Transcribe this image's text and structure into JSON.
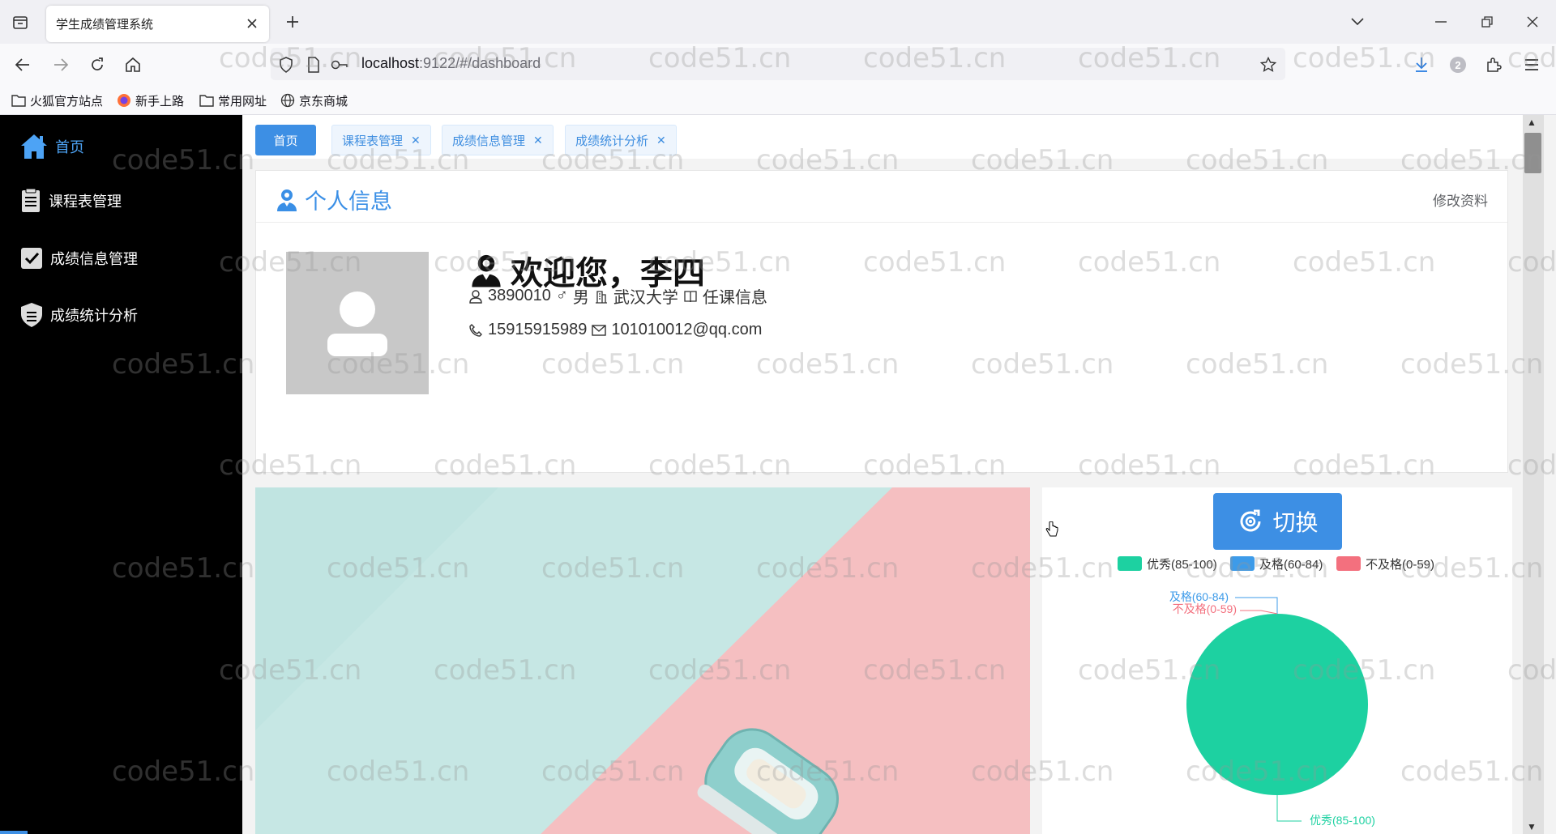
{
  "browser": {
    "tab_title": "学生成绩管理系统",
    "url_host": "localhost",
    "url_rest": ":9122/#/dashboard",
    "bookmarks": [
      "火狐官方站点",
      "新手上路",
      "常用网址",
      "京东商城"
    ],
    "badge_count": "2"
  },
  "sidebar": {
    "items": [
      {
        "label": "首页",
        "icon": "home-icon"
      },
      {
        "label": "课程表管理",
        "icon": "schedule-icon"
      },
      {
        "label": "成绩信息管理",
        "icon": "check-icon"
      },
      {
        "label": "成绩统计分析",
        "icon": "shield-icon"
      }
    ]
  },
  "tags": [
    {
      "label": "首页"
    },
    {
      "label": "课程表管理"
    },
    {
      "label": "成绩信息管理"
    },
    {
      "label": "成绩统计分析"
    }
  ],
  "profile": {
    "card_title": "个人信息",
    "edit_label": "修改资料",
    "welcome": "欢迎您，李四",
    "student_id": "3890010",
    "gender": "男",
    "school": "武汉大学",
    "role": "任课信息",
    "phone": "15915915989",
    "email": "101010012@qq.com"
  },
  "chart": {
    "switch_label": "切换"
  },
  "chart_data": {
    "type": "pie",
    "categories": [
      "优秀(85-100)",
      "及格(60-84)",
      "不及格(0-59)"
    ],
    "values": [
      100,
      0,
      0
    ],
    "colors": [
      "#1dd1a1",
      "#3d9be9",
      "#f3707e"
    ],
    "legend_position": "top"
  },
  "watermark": "code51.cn",
  "colors": {
    "accent": "#3d8fe4",
    "sidebar_bg": "#000000"
  }
}
